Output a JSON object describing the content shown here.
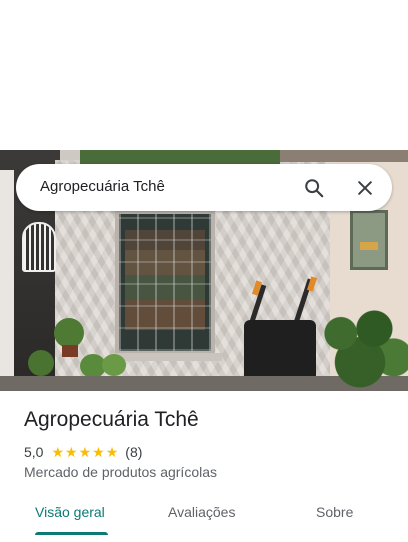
{
  "search": {
    "query": "Agropecuária Tchê",
    "search_icon": "search-icon",
    "close_icon": "close-icon"
  },
  "place": {
    "name": "Agropecuária Tchê",
    "rating": "5,0",
    "stars": 5,
    "review_count": "(8)",
    "category": "Mercado de produtos agrícolas"
  },
  "tabs": [
    {
      "label": "Visão geral",
      "active": true
    },
    {
      "label": "Avaliações",
      "active": false
    },
    {
      "label": "Sobre",
      "active": false
    }
  ],
  "colors": {
    "accent": "#0b7a74",
    "star": "#fbbc04"
  }
}
